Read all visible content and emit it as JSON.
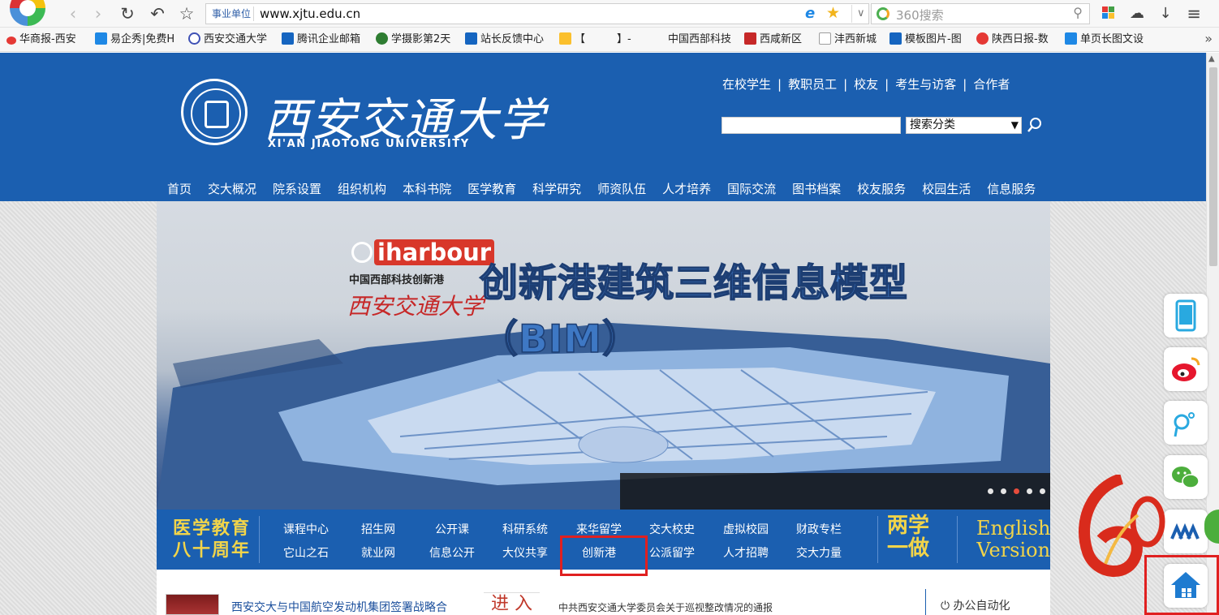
{
  "browser": {
    "address_badge": "事业单位",
    "url": "www.xjtu.edu.cn",
    "search_placeholder": "360搜索",
    "more_glyph": "≡",
    "bookmarks_more": "»"
  },
  "bookmarks": [
    {
      "label": "华商报-西安",
      "icon_color": "#e53935"
    },
    {
      "label": "易企秀|免费H",
      "icon_color": "#1e88e5"
    },
    {
      "label": "西安交通大学",
      "icon_color": "#3f51b5"
    },
    {
      "label": "腾讯企业邮箱",
      "icon_color": "#1565c0"
    },
    {
      "label": "学摄影第2天",
      "icon_color": "#2e7d32"
    },
    {
      "label": "站长反馈中心",
      "icon_color": "#1565c0"
    },
    {
      "label": "【　　　】-",
      "icon_color": "#fbc02d"
    },
    {
      "label": "中国西部科技",
      "icon_color": ""
    },
    {
      "label": "西咸新区",
      "icon_color": "#c62828"
    },
    {
      "label": "沣西新城",
      "icon_color": "#9e9e9e"
    },
    {
      "label": "模板图片-图",
      "icon_color": "#1565c0"
    },
    {
      "label": "陕西日报-数",
      "icon_color": "#e53935"
    },
    {
      "label": "单页长图文设",
      "icon_color": "#1e88e5"
    }
  ],
  "header": {
    "logo_cn": "西安交通大学",
    "logo_en": "XI'AN JIAOTONG UNIVERSITY",
    "toplinks": [
      "在校学生",
      "教职员工",
      "校友",
      "考生与访客",
      "合作者"
    ],
    "toplinks_sep": "|",
    "search_select": "搜索分类"
  },
  "mainnav": [
    "首页",
    "交大概况",
    "院系设置",
    "组织机构",
    "本科书院",
    "医学教育",
    "科学研究",
    "师资队伍",
    "人才培养",
    "国际交流",
    "图书档案",
    "校友服务",
    "校园生活",
    "信息服务"
  ],
  "banner": {
    "ih_logo": "iharbour",
    "ih_subtitle": "中国西部科技创新港",
    "ih_calligraphy": "西安交通大学",
    "title": "创新港建筑三维信息模型（BIM）",
    "dots": 5,
    "active_dot": 2
  },
  "quickbar": {
    "left_line1": "医学教育",
    "left_line2": "八十周年",
    "row1": [
      "课程中心",
      "招生网",
      "公开课",
      "科研系统",
      "来华留学",
      "交大校史",
      "虚拟校园",
      "财政专栏"
    ],
    "row2": [
      "它山之石",
      "就业网",
      "信息公开",
      "大仪共享",
      "创新港",
      "公派留学",
      "人才招聘",
      "交大力量"
    ],
    "liang_line1": "两学",
    "liang_line2": "一做",
    "english_line1": "English",
    "english_line2": "Version"
  },
  "news": {
    "headline": "西安交大与中国航空发动机集团签署战略合",
    "enter": "进 入",
    "second": "中共西安交通大学委员会关于巡视整改情况的通报",
    "oa": "办公自动化"
  },
  "colors": {
    "brand_blue": "#1b5fb0",
    "gold": "#f1d44a",
    "highlight_red": "#e02020"
  }
}
